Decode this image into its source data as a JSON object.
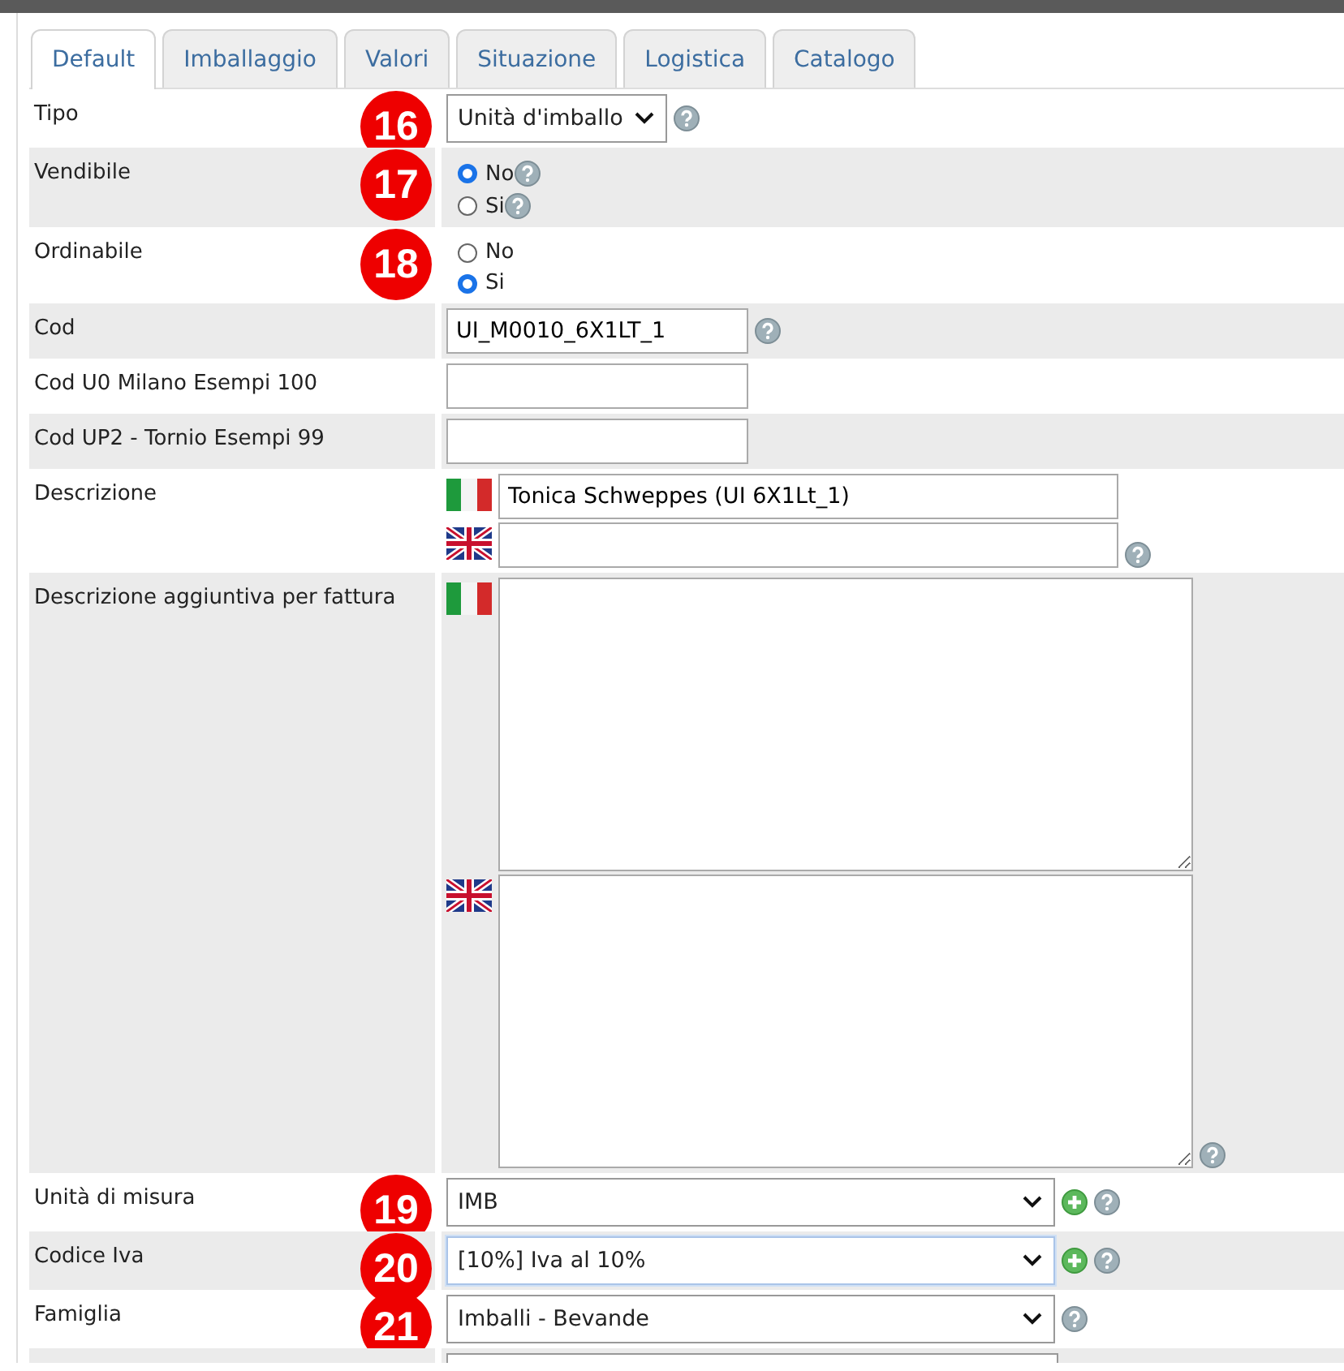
{
  "tabs": [
    {
      "label": "Default",
      "selected": true
    },
    {
      "label": "Imballaggio",
      "selected": false
    },
    {
      "label": "Valori",
      "selected": false
    },
    {
      "label": "Situazione",
      "selected": false
    },
    {
      "label": "Logistica",
      "selected": false
    },
    {
      "label": "Catalogo",
      "selected": false
    }
  ],
  "rows": [
    {
      "kind": "compact_select",
      "label": "Tipo",
      "marker": "16",
      "value": "Unità d'imballo",
      "help": true,
      "add": false
    },
    {
      "kind": "radio",
      "label": "Vendibile",
      "marker": "17",
      "options": [
        {
          "label": "No",
          "selected": true,
          "help": true
        },
        {
          "label": "Si",
          "selected": false,
          "help": true
        }
      ]
    },
    {
      "kind": "radio",
      "label": "Ordinabile",
      "marker": "18",
      "options": [
        {
          "label": "No",
          "selected": false,
          "help": false
        },
        {
          "label": "Si",
          "selected": true,
          "help": false
        }
      ]
    },
    {
      "kind": "text",
      "label": "Cod",
      "value": "UI_M0010_6X1LT_1",
      "help": true
    },
    {
      "kind": "text",
      "label": "Cod U0 Milano Esempi 100",
      "help": false
    },
    {
      "kind": "text",
      "label": "Cod UP2 - Tornio Esempi 99",
      "help": false
    },
    {
      "kind": "multilang_text",
      "label": "Descrizione",
      "langs": [
        {
          "kind": "italian",
          "text": "Tonica Schweppes (UI 6X1Lt_1)",
          "help": false
        },
        {
          "kind": "english",
          "help": true
        }
      ]
    },
    {
      "kind": "multilang_textarea",
      "label": "Descrizione aggiuntiva per fattura",
      "langs": [
        {
          "kind": "italian",
          "help": false
        },
        {
          "kind": "english",
          "help": true
        }
      ]
    },
    {
      "kind": "select",
      "label": "Unità di misura",
      "marker": "19",
      "value": "IMB",
      "help": true,
      "add": true
    },
    {
      "kind": "select",
      "label": "Codice Iva",
      "marker": "20",
      "value": "[10%] Iva al 10%",
      "help": true,
      "add": true,
      "focused": true
    },
    {
      "kind": "select",
      "label": "Famiglia",
      "marker": "21",
      "value": "Imballi - Bevande",
      "help": true,
      "add": false
    },
    {
      "kind": "partial"
    }
  ]
}
